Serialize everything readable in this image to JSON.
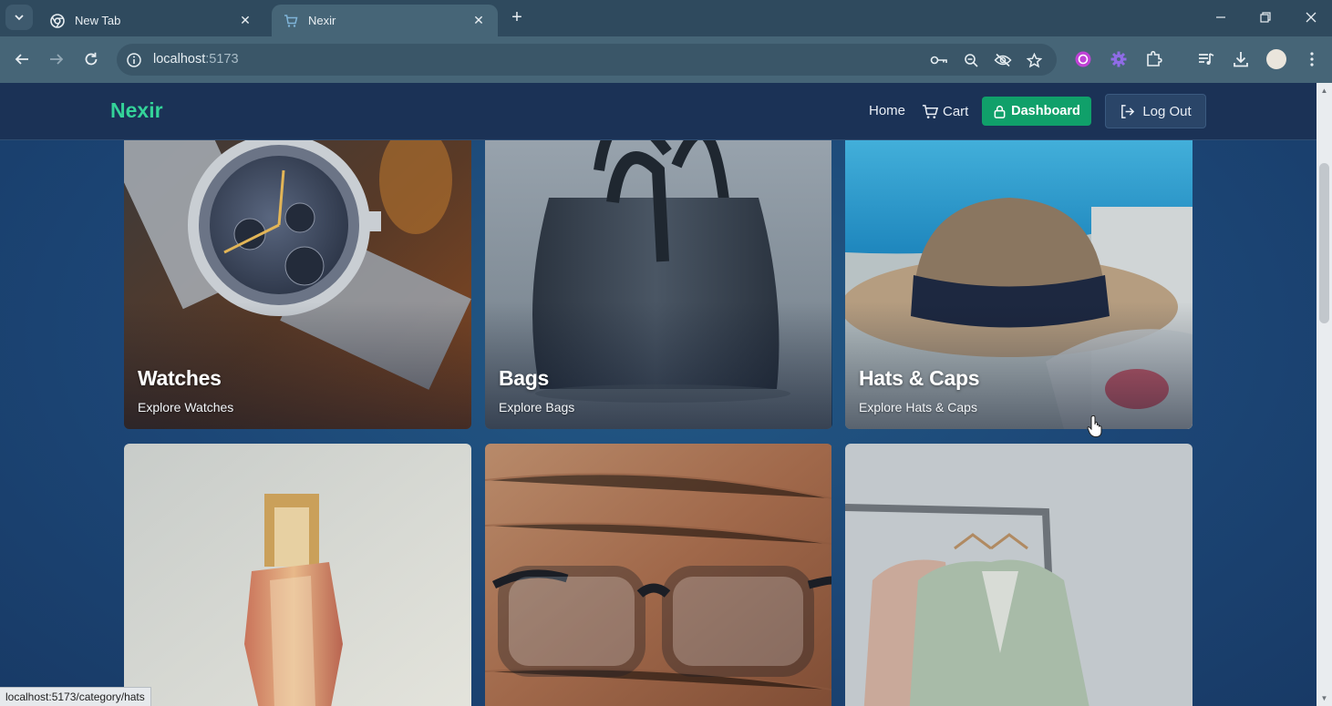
{
  "browser": {
    "tabs": [
      {
        "title": "New Tab",
        "icon": "chrome-icon",
        "active": false
      },
      {
        "title": "Nexir",
        "icon": "cart-favicon",
        "active": true
      }
    ],
    "address": {
      "host": "localhost",
      "port": ":5173"
    },
    "status_url": "localhost:5173/category/hats",
    "extension_icons": [
      "password-key-icon",
      "zoom-icon",
      "eye-off-icon",
      "star-icon",
      "extension-purple-icon",
      "extension-gear-icon",
      "puzzle-icon",
      "media-icon",
      "download-icon",
      "profile-avatar",
      "menu-icon"
    ]
  },
  "site": {
    "brand": "Nexir",
    "brand_color": "#34d399",
    "nav": {
      "home": "Home",
      "cart": "Cart",
      "dashboard": "Dashboard",
      "logout": "Log Out"
    }
  },
  "categories": [
    {
      "title": "Watches",
      "subtitle": "Explore Watches",
      "image": "watch-photo"
    },
    {
      "title": "Bags",
      "subtitle": "Explore Bags",
      "image": "handbag-photo"
    },
    {
      "title": "Hats & Caps",
      "subtitle": "Explore Hats & Caps",
      "image": "hat-photo"
    },
    {
      "title": "",
      "subtitle": "",
      "image": "perfume-photo"
    },
    {
      "title": "",
      "subtitle": "",
      "image": "glasses-photo"
    },
    {
      "title": "",
      "subtitle": "",
      "image": "clothes-rack-photo"
    }
  ]
}
